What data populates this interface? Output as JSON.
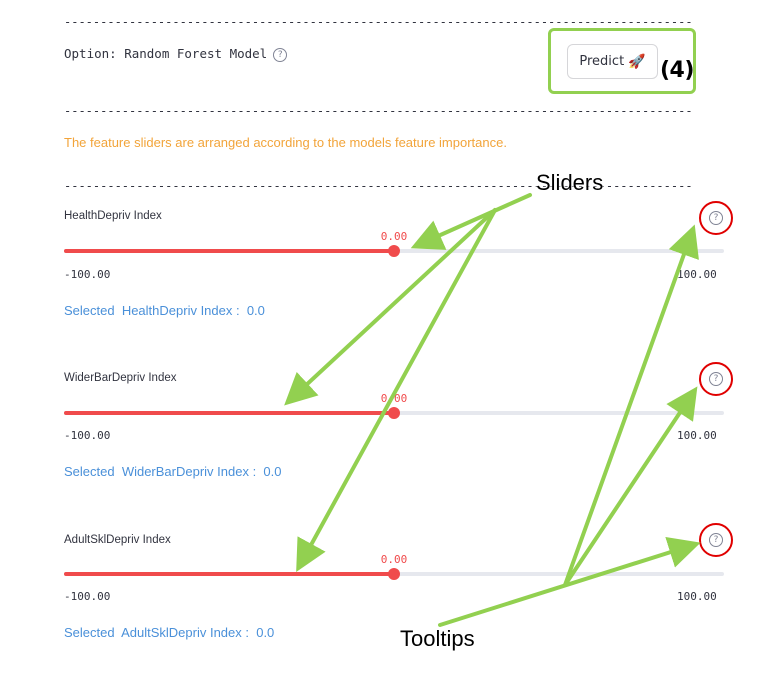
{
  "divider": "------------------------------------------------------------------------------------------------------------------------",
  "option": {
    "text": "Option: Random Forest Model"
  },
  "help_icon": "?",
  "predict": {
    "label": "Predict",
    "icon": "🚀",
    "step": "(4)"
  },
  "info_text": "The feature sliders are arranged according to the models feature importance.",
  "sliders": [
    {
      "label": "HealthDepriv Index",
      "value": "0.00",
      "value_num": 0.0,
      "min": "-100.00",
      "max": "100.00",
      "selected": "Selected  HealthDepriv Index :  0.0"
    },
    {
      "label": "WiderBarDepriv Index",
      "value": "0.00",
      "value_num": 0.0,
      "min": "-100.00",
      "max": "100.00",
      "selected": "Selected  WiderBarDepriv Index :  0.0"
    },
    {
      "label": "AdultSklDepriv Index",
      "value": "0.00",
      "value_num": 0.0,
      "min": "-100.00",
      "max": "100.00",
      "selected": "Selected  AdultSklDepriv Index :  0.0"
    }
  ],
  "annotations": {
    "sliders": "Sliders",
    "tooltips": "Tooltips"
  },
  "colors": {
    "slider_red": "#f04b4c",
    "annotation_green": "#92d050",
    "tooltip_ring": "#e00000",
    "info_orange": "#f2a43a",
    "selected_blue": "#4a90d9"
  }
}
